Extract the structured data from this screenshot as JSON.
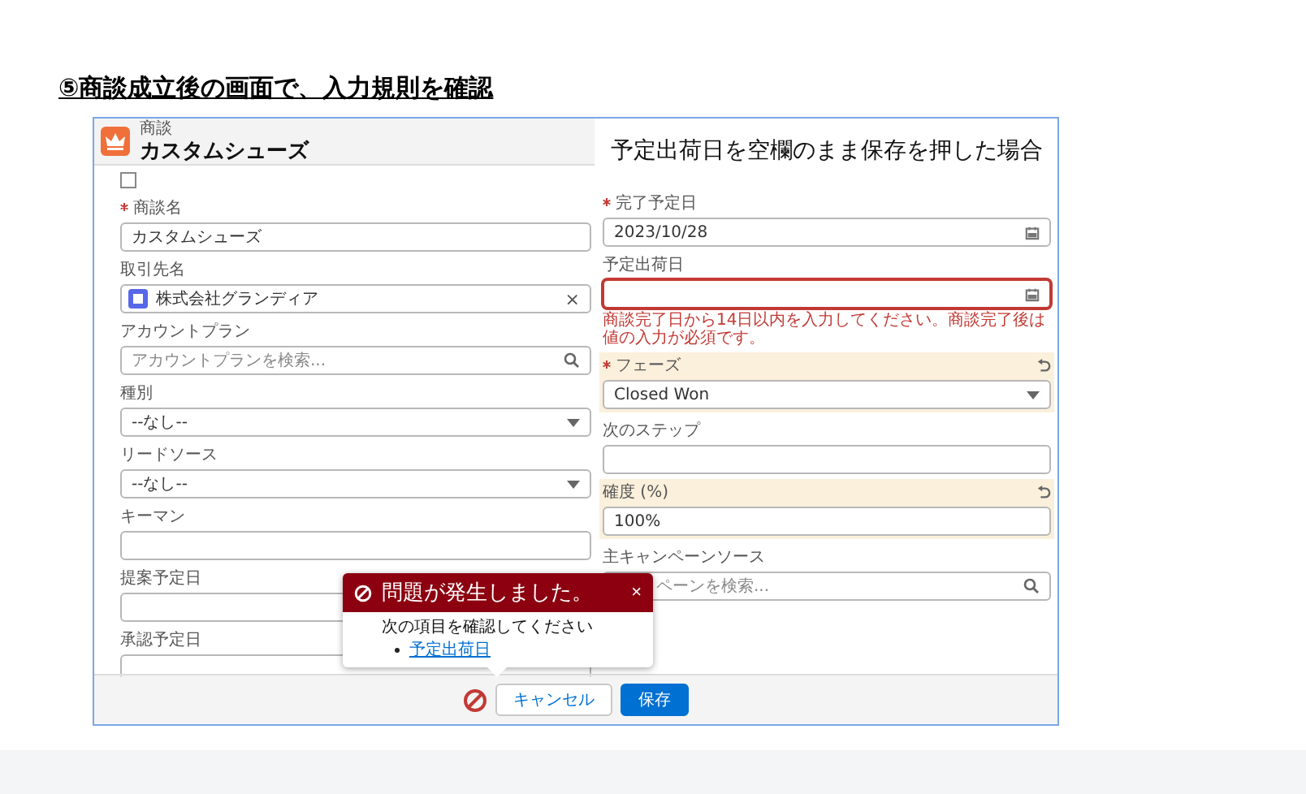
{
  "heading": "⑤商談成立後の画面で、入力規則を確認",
  "record": {
    "object_label": "商談",
    "title": "カスタムシューズ"
  },
  "annotation": "予定出荷日を空欄のまま保存を押した場合",
  "checkbox": {
    "checked": false
  },
  "left_fields": [
    {
      "kind": "text",
      "label": "商談名",
      "required": true,
      "changed": false,
      "invalid": false,
      "value": "カスタムシューズ"
    },
    {
      "kind": "lookup",
      "label": "取引先名",
      "required": false,
      "changed": false,
      "invalid": false,
      "value": "株式会社グランディア",
      "clear": "×"
    },
    {
      "kind": "search",
      "label": "アカウントプラン",
      "required": false,
      "changed": false,
      "invalid": false,
      "placeholder": "アカウントプランを検索..."
    },
    {
      "kind": "select",
      "label": "種別",
      "required": false,
      "changed": false,
      "invalid": false,
      "value": "--なし--"
    },
    {
      "kind": "select",
      "label": "リードソース",
      "required": false,
      "changed": false,
      "invalid": false,
      "value": "--なし--"
    },
    {
      "kind": "text",
      "label": "キーマン",
      "required": false,
      "changed": false,
      "invalid": false
    },
    {
      "kind": "text",
      "label": "提案予定日",
      "required": false,
      "changed": false,
      "invalid": false
    },
    {
      "kind": "text",
      "label": "承認予定日",
      "required": false,
      "changed": false,
      "invalid": false
    }
  ],
  "right_fields": [
    {
      "kind": "date",
      "label": "完了予定日",
      "required": true,
      "changed": false,
      "invalid": false,
      "value": "2023/10/28"
    },
    {
      "kind": "date",
      "label": "予定出荷日",
      "required": false,
      "changed": false,
      "invalid": true,
      "error": "商談完了日から14日以内を入力してください。商談完了後は値の入力が必須です。"
    },
    {
      "kind": "select",
      "label": "フェーズ",
      "required": true,
      "changed": true,
      "invalid": false,
      "value": "Closed Won"
    },
    {
      "kind": "text",
      "label": "次のステップ",
      "required": false,
      "changed": false,
      "invalid": false
    },
    {
      "kind": "text",
      "label": "確度 (%)",
      "required": false,
      "changed": true,
      "invalid": false,
      "value": "100%"
    },
    {
      "kind": "search",
      "label": "主キャンペーンソース",
      "required": false,
      "changed": false,
      "invalid": false,
      "placeholder": "ペーンを検索...",
      "covered": true
    }
  ],
  "popover": {
    "title": "問題が発生しました。",
    "close": "×",
    "message": "次の項目を確認してください",
    "links": [
      "予定出荷日"
    ]
  },
  "footer": {
    "buttons": [
      {
        "kind": "neutral",
        "label": "キャンセル"
      },
      {
        "kind": "brand",
        "label": "保存"
      }
    ]
  }
}
